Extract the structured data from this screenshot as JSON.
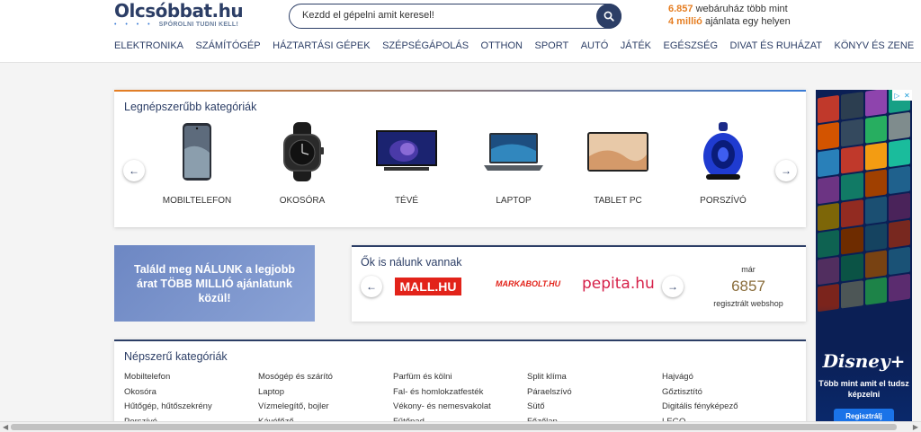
{
  "header": {
    "logo_title": "Olcsóbbat.hu",
    "logo_slogan": "SPÓROLNI TUDNI KELL!",
    "search_placeholder": "Kezdd el gépelni amit keresel!",
    "stats_line1_num": "6.857",
    "stats_line1_text": " webáruház több mint",
    "stats_line2_num": "4 millió",
    "stats_line2_text": " ajánlata egy helyen"
  },
  "nav": [
    "ELEKTRONIKA",
    "SZÁMÍTÓGÉP",
    "HÁZTARTÁSI GÉPEK",
    "SZÉPSÉGÁPOLÁS",
    "OTTHON",
    "SPORT",
    "AUTÓ",
    "JÁTÉK",
    "EGÉSZSÉG",
    "DIVAT ÉS RUHÁZAT",
    "KÖNYV ÉS ZENE"
  ],
  "top_categories": {
    "title": "Legnépszerűbb kategóriák",
    "items": [
      "MOBILTELEFON",
      "OKOSÓRA",
      "TÉVÉ",
      "LAPTOP",
      "TABLET PC",
      "PORSZÍVÓ"
    ]
  },
  "promo": {
    "text": "Találd meg NÁLUNK a legjobb árat TÖBB MILLIÓ ajánlatunk közül!"
  },
  "partners": {
    "title": "Ők is nálunk vannak",
    "logos": [
      "MALL.HU",
      "MARKABOLT.HU",
      "pepita.hu"
    ],
    "count_prefix": "már",
    "count": "6857",
    "count_suffix": "regisztrált webshop"
  },
  "popular": {
    "title": "Népszerű kategóriák",
    "columns": [
      [
        "Mobiltelefon",
        "Okosóra",
        "Hűtőgép, hűtőszekrény",
        "Porszívó"
      ],
      [
        "Mosógép és szárító",
        "Laptop",
        "Vízmelegítő, bojler",
        "Kávéfőző"
      ],
      [
        "Parfüm és kölni",
        "Fal- és homlokzatfesték",
        "Vékony- és nemesvakolat",
        "Fűtőpad"
      ],
      [
        "Split klíma",
        "Páraelszívó",
        "Sütő",
        "Főzőlap"
      ],
      [
        "Hajvágó",
        "Gőztisztító",
        "Digitális fényképező",
        "LEGO"
      ]
    ]
  },
  "ad": {
    "logo": "Disney+",
    "text": "Több mint amit el tudsz képzelni",
    "button": "Regisztrálj"
  },
  "colors": {
    "brand_navy": "#2c3e66",
    "accent_orange": "#e67e22",
    "mall_red": "#e2231a",
    "pepita_red": "#d6224a"
  }
}
